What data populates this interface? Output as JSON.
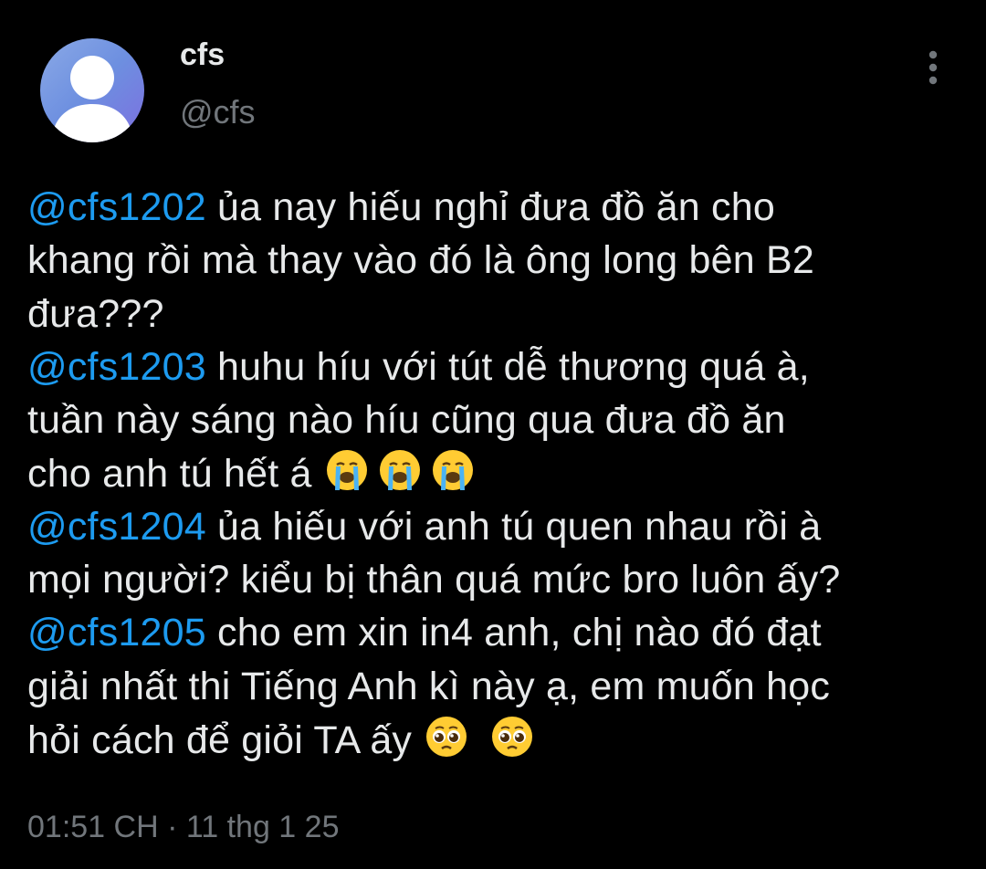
{
  "user": {
    "display_name": "cfs",
    "handle": "@cfs",
    "avatar_icon": "default-avatar-icon"
  },
  "more_icon": "more-vertical-icon",
  "colors": {
    "background": "#000000",
    "text": "#e7e9ea",
    "mention": "#1d9bf0",
    "secondary": "#71767b"
  },
  "tweet": {
    "mentions": [
      "@cfs1202",
      "@cfs1203",
      "@cfs1204",
      "@cfs1205"
    ],
    "lines": [
      " ủa nay hiếu nghỉ đưa đồ ăn cho",
      "khang rồi mà thay vào đó là ông long bên B2",
      "đưa???",
      " huhu híu với tút dễ thương quá à,",
      "tuần này sáng nào híu cũng qua đưa đồ ăn",
      "cho anh tú hết á ",
      " ủa hiếu với anh tú quen nhau rồi à",
      "mọi người? kiểu bị thân quá mức bro luôn ấy?",
      " cho em xin in4 anh, chị nào đó đạt",
      "giải nhất thi Tiếng Anh kì này ạ, em muốn học",
      "hỏi cách để giỏi TA ấy "
    ],
    "emojis": {
      "crying": "loudly-crying-face-emoji",
      "pleading": "pleading-face-emoji"
    }
  },
  "meta": {
    "time": "01:51 CH",
    "separator": " · ",
    "date": "11 thg 1 25"
  }
}
